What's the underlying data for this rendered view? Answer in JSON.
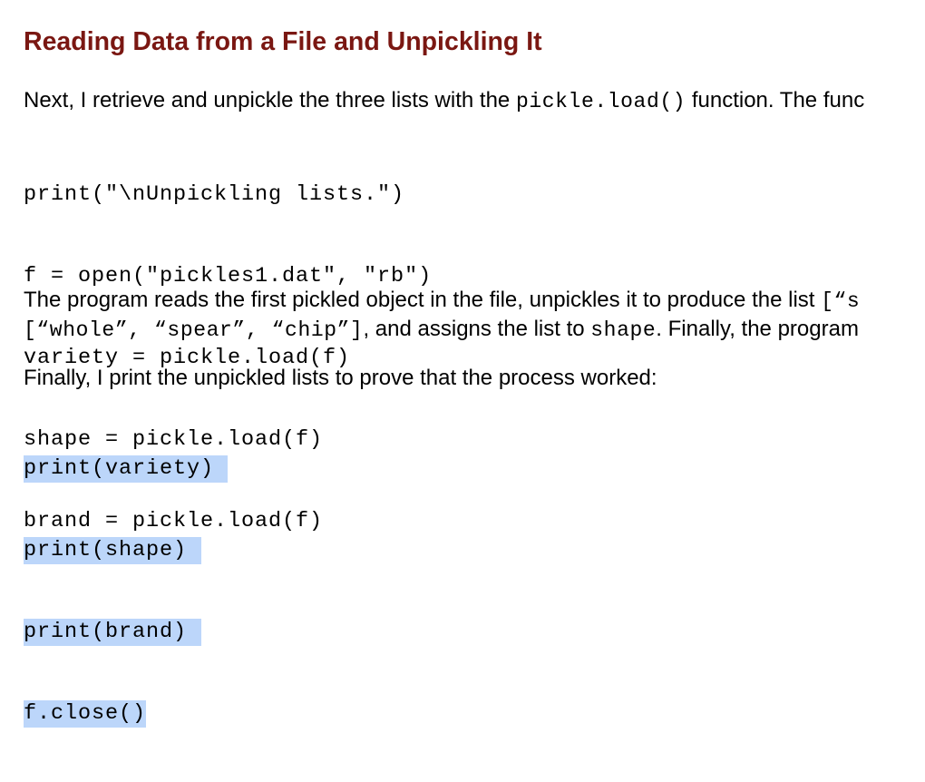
{
  "heading": "Reading Data from a File and Unpickling It",
  "intro": {
    "text_before": "Next, I retrieve and unpickle the three lists with the ",
    "code": "pickle.load()",
    "text_after": " function. The func"
  },
  "code_block_1": [
    "print(\"\\nUnpickling lists.\")",
    "f = open(\"pickles1.dat\", \"rb\")",
    "variety = pickle.load(f)",
    "shape = pickle.load(f)",
    "brand = pickle.load(f)"
  ],
  "explanation": {
    "line1_text": "The program reads the first pickled object in the file, unpickles it to produce the list ",
    "line1_code": "[“s",
    "line2_code1": "[“whole”, “spear”, “chip”]",
    "line2_text1": ", and assigns the list to ",
    "line2_code2": "shape",
    "line2_text2": ". Finally, the program"
  },
  "finally_text": "Finally, I print the unpickled lists to prove that the process worked:",
  "code_block_2": [
    "print(variety) ",
    "print(shape)",
    "print(brand)",
    "f.close()"
  ],
  "colors": {
    "heading": "#7a1712",
    "selection": "#bcd6fa"
  }
}
